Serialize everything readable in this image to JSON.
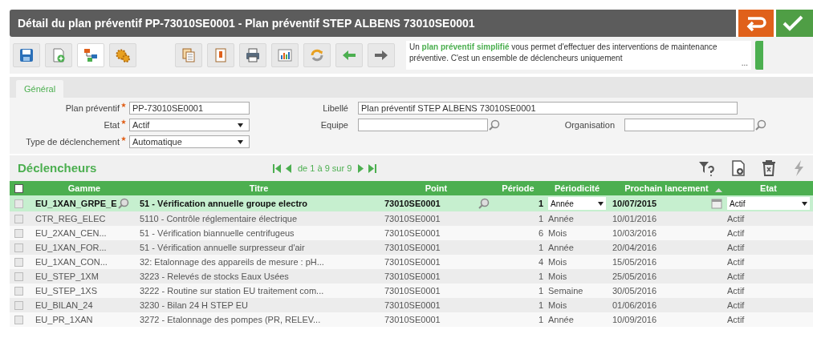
{
  "window": {
    "title": "Détail du plan préventif PP-73010SE0001 - Plan préventif STEP ALBENS 73010SE0001"
  },
  "toolbar": {
    "info": "Un **plan préventif simplifié** vous permet d'effectuer des interventions de maintenance préventive. C'est un ensemble de déclencheurs uniquement",
    "info_more": "..."
  },
  "tabs": [
    {
      "label": "Général",
      "selected": true
    }
  ],
  "form": {
    "rows": [
      [
        {
          "label": "Plan préventif",
          "value": "PP-73010SE0001",
          "required": true,
          "kind": "text"
        },
        {
          "label": "Libellé",
          "value": "Plan préventif STEP ALBENS 73010SE0001",
          "required": false,
          "kind": "wide"
        }
      ],
      [
        {
          "label": "Etat",
          "value": "Actif",
          "required": true,
          "kind": "select"
        },
        {
          "label": "Equipe",
          "required": false,
          "kind": "lookup"
        },
        {
          "label": "Organisation",
          "required": false,
          "kind": "lookup"
        }
      ],
      [
        {
          "label": "Type de déclenchement",
          "value": "Automatique",
          "required": true,
          "kind": "select"
        }
      ]
    ]
  },
  "section": {
    "title": "Déclencheurs",
    "pagination": "de 1 à 9 sur 9"
  },
  "table": {
    "header_checked": false,
    "columns": [
      {
        "label": "Gamme",
        "sorted": false
      },
      {
        "label": "Titre",
        "sorted": false
      },
      {
        "label": "Point",
        "sorted": false
      },
      {
        "label": "Période",
        "sorted": false
      },
      {
        "label": "Périodicité",
        "sorted": false
      },
      {
        "label": "Prochain lancement",
        "sorted": true
      },
      {
        "label": "Etat",
        "sorted": false
      }
    ],
    "rows": [
      {
        "selected": true,
        "checked": false,
        "cells": [
          "EU_1XAN_GRPE_E",
          "51 - Vérification annuelle groupe electro",
          "73010SE0001",
          "1",
          "Année",
          "10/07/2015",
          "Actif"
        ]
      },
      {
        "selected": false,
        "checked": false,
        "cells": [
          "CTR_REG_ELEC",
          "5110 - Contrôle réglementaire électrique",
          "73010SE0001",
          "1",
          "Année",
          "10/01/2016",
          "Actif"
        ]
      },
      {
        "selected": false,
        "checked": false,
        "cells": [
          "EU_2XAN_CEN...",
          "51 - Vérification biannuelle centrifugeus",
          "73010SE0001",
          "6",
          "Mois",
          "10/03/2016",
          "Actif"
        ]
      },
      {
        "selected": false,
        "checked": false,
        "cells": [
          "EU_1XAN_FOR...",
          "51 - Vérification annuelle surpresseur d'air",
          "73010SE0001",
          "1",
          "Année",
          "20/04/2016",
          "Actif"
        ]
      },
      {
        "selected": false,
        "checked": false,
        "cells": [
          "EU_1XAN_CON...",
          "32: Etalonnage des appareils de mesure : pH...",
          "73010SE0001",
          "4",
          "Mois",
          "15/05/2016",
          "Actif"
        ]
      },
      {
        "selected": false,
        "checked": false,
        "cells": [
          "EU_STEP_1XM",
          "3223 - Relevés de stocks Eaux Usées",
          "73010SE0001",
          "1",
          "Mois",
          "25/05/2016",
          "Actif"
        ]
      },
      {
        "selected": false,
        "checked": false,
        "cells": [
          "EU_STEP_1XS",
          "3222 - Routine sur station EU traitement com...",
          "73010SE0001",
          "1",
          "Semaine",
          "30/05/2016",
          "Actif"
        ]
      },
      {
        "selected": false,
        "checked": false,
        "cells": [
          "EU_BILAN_24",
          "3230 - Bilan 24 H STEP EU",
          "73010SE0001",
          "1",
          "Mois",
          "01/06/2016",
          "Actif"
        ]
      },
      {
        "selected": false,
        "checked": false,
        "cells": [
          "EU_PR_1XAN",
          "3272 - Etalonnage des pompes (PR, RELEV...",
          "73010SE0001",
          "1",
          "Année",
          "10/09/2016",
          "Actif"
        ]
      }
    ]
  }
}
